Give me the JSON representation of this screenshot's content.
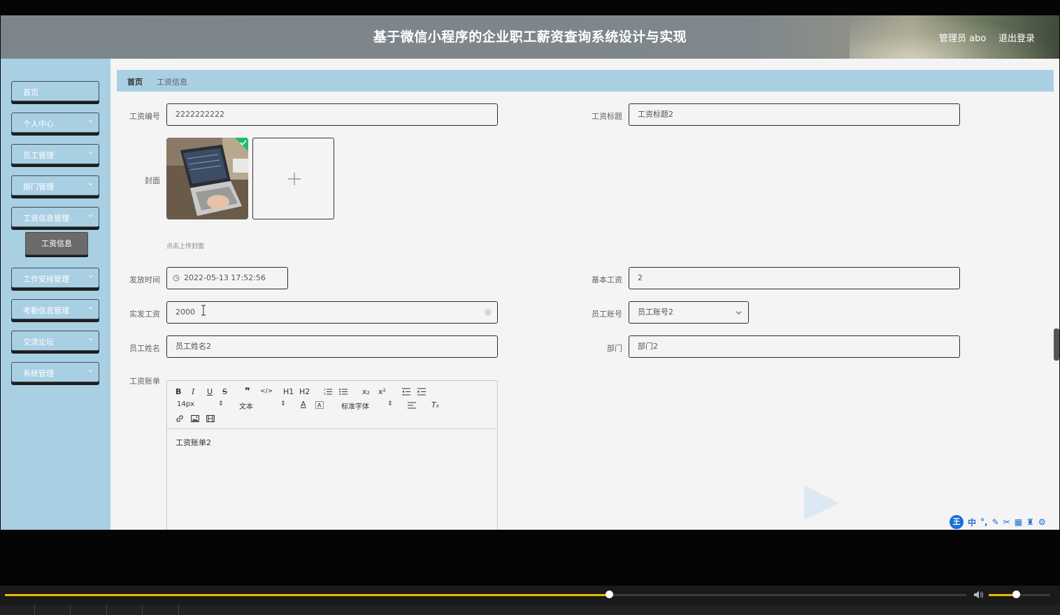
{
  "header": {
    "title": "基于微信小程序的企业职工薪资查询系统设计与实现",
    "user": "管理员 abo",
    "logout": "退出登录"
  },
  "sidebar": {
    "items": [
      {
        "label": "首页",
        "has_children": false
      },
      {
        "label": "个人中心",
        "has_children": true
      },
      {
        "label": "员工管理",
        "has_children": true
      },
      {
        "label": "部门管理",
        "has_children": true
      },
      {
        "label": "工资信息管理",
        "has_children": true,
        "expanded": true
      },
      {
        "label": "工作安排管理",
        "has_children": true
      },
      {
        "label": "考勤信息管理",
        "has_children": true
      },
      {
        "label": "交流论坛",
        "has_children": true
      },
      {
        "label": "系统管理",
        "has_children": true
      }
    ],
    "sub_item": "工资信息"
  },
  "breadcrumb": {
    "home": "首页",
    "current": "工资信息"
  },
  "form": {
    "salary_no": {
      "label": "工资编号",
      "value": "2222222222"
    },
    "salary_title": {
      "label": "工资标题",
      "value": "工资标题2"
    },
    "cover": {
      "label": "封面",
      "tip": "点击上传封面"
    },
    "issue_time": {
      "label": "发放时间",
      "value": "2022-05-13 17:52:56"
    },
    "base_salary": {
      "label": "基本工资",
      "value": "2"
    },
    "actual_salary": {
      "label": "实发工资",
      "value": "2000"
    },
    "employee_account": {
      "label": "员工账号",
      "value": "员工账号2"
    },
    "employee_name": {
      "label": "员工姓名",
      "value": "员工姓名2"
    },
    "department": {
      "label": "部门",
      "value": "部门2"
    },
    "salary_bill": {
      "label": "工资账单",
      "content": "工资账单2"
    }
  },
  "editor": {
    "font_size": "14px",
    "block_type": "文本",
    "font_family": "标准字体",
    "buttons_row1": [
      "B",
      "I",
      "U",
      "S",
      "❞",
      "</>",
      "H1",
      "H2",
      "ol",
      "ul",
      "x₂",
      "x²",
      "outdent",
      "indent"
    ]
  },
  "ime": {
    "brand": "王",
    "mode": "中"
  },
  "player": {
    "progress": 0.628,
    "volume": 0.44
  },
  "colors": {
    "sidebar_bg": "#a9cfe3",
    "header_bg": "#7f878c",
    "accent": "#e6b800"
  }
}
